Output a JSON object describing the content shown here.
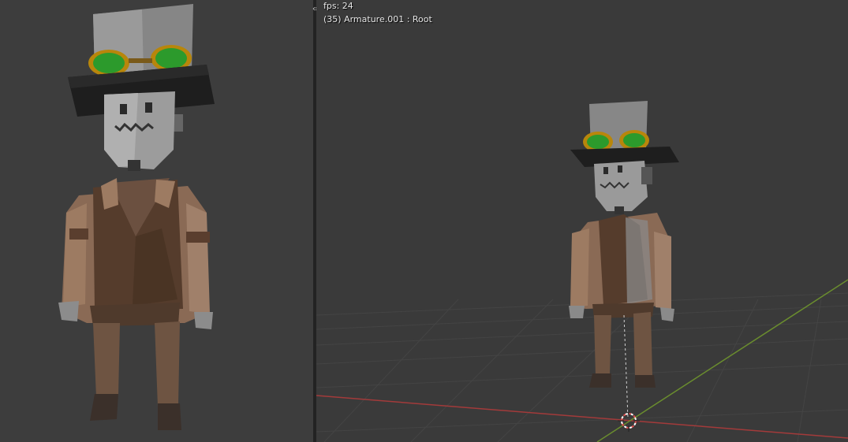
{
  "viewport_right": {
    "fps_label": "fps: 24",
    "active_object_label": "(35) Armature.001 : Root"
  },
  "split_handle": {
    "icon": "split-arrows-icon",
    "glyph": "‹›"
  },
  "colors": {
    "viewport_bg": "#3a3a3a",
    "grid_line": "#454545",
    "x_axis": "#a33a3a",
    "y_axis": "#6a8d2e",
    "hat_top": "#8a8a8a",
    "hat_brim": "#1e1e1e",
    "goggle_lens": "#2a9a2a",
    "goggle_rim": "#b8860b",
    "head_metal": "#9a9a9a",
    "vest": "#5a4030",
    "coat": "#8a6a55",
    "legs": "#6a5040",
    "shoes": "#3a2e28"
  }
}
